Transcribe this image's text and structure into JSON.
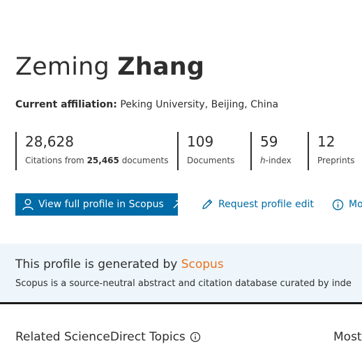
{
  "profile": {
    "first_name": "Zeming",
    "last_name": "Zhang",
    "affiliation_label": "Current affiliation:",
    "affiliation_value": "Peking University, Beijing, China"
  },
  "metrics": {
    "citations": {
      "value": "28,628",
      "label_prefix": "Citations from",
      "label_count": "25,465",
      "label_suffix": "documents"
    },
    "documents": {
      "value": "109",
      "label": "Documents"
    },
    "h_index": {
      "value": "59",
      "label_italic": "h",
      "label_rest": "-index"
    },
    "preprints": {
      "value": "12",
      "label": "Preprints"
    }
  },
  "actions": {
    "view_profile": "View full profile in Scopus",
    "request_edit": "Request profile edit",
    "more": "Mo"
  },
  "banner": {
    "heading_prefix": "This profile is generated by",
    "heading_brand": "Scopus",
    "description": "Scopus is a source-neutral abstract and citation database curated by inde",
    "brand_color": "#e9711c",
    "background": "#eef6fc"
  },
  "below": {
    "related_topics": "Related ScienceDirect Topics",
    "right_heading": "Most"
  },
  "colors": {
    "primary": "#006ba6",
    "text": "#2e2e2e"
  }
}
